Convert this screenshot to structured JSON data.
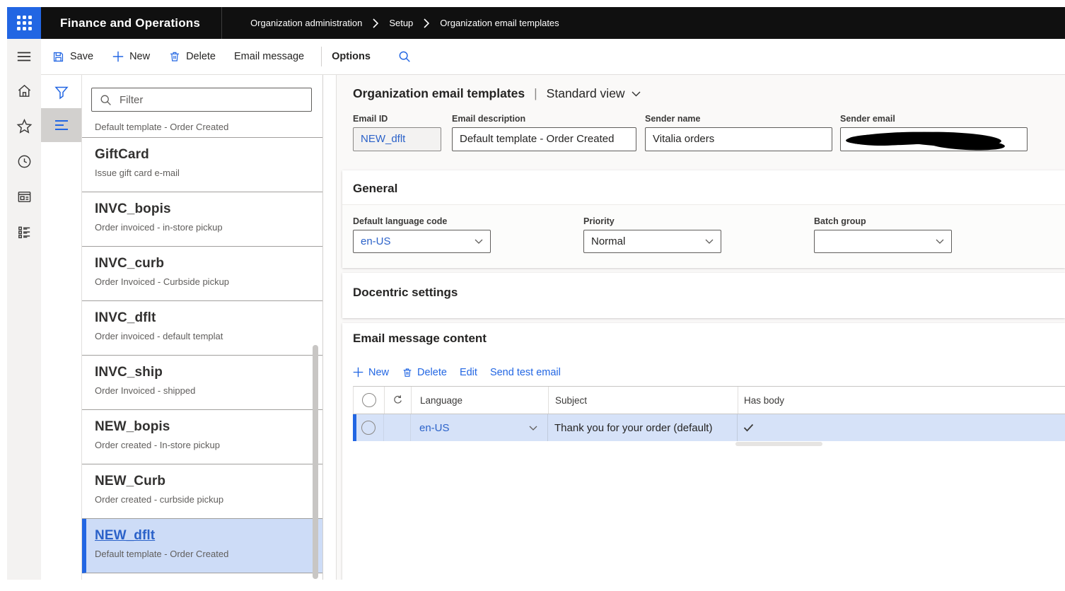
{
  "colors": {
    "accent": "#2266E3",
    "selected_row_bg": "#d6e2f8",
    "selected_item_bg": "#cddcf7",
    "topbar_bg": "#101010"
  },
  "topbar": {
    "app_title": "Finance and Operations",
    "breadcrumb": [
      "Organization administration",
      "Setup",
      "Organization email templates"
    ]
  },
  "toolbar": {
    "save_label": "Save",
    "new_label": "New",
    "delete_label": "Delete",
    "email_message_label": "Email message",
    "options_label": "Options"
  },
  "list_panel": {
    "filter_placeholder": "Filter",
    "clipped_item_subtitle": "Default template - Order Created",
    "items": [
      {
        "id": "GiftCard",
        "desc": "Issue gift card e-mail",
        "selected": false
      },
      {
        "id": "INVC_bopis",
        "desc": "Order invoiced - in-store pickup",
        "selected": false
      },
      {
        "id": "INVC_curb",
        "desc": "Order Invoiced - Curbside pickup",
        "selected": false
      },
      {
        "id": "INVC_dflt",
        "desc": "Order invoiced - default templat",
        "selected": false
      },
      {
        "id": "INVC_ship",
        "desc": "Order Invoiced - shipped",
        "selected": false
      },
      {
        "id": "NEW_bopis",
        "desc": "Order created - In-store pickup",
        "selected": false
      },
      {
        "id": "NEW_Curb",
        "desc": "Order created - curbside pickup",
        "selected": false
      },
      {
        "id": "NEW_dflt",
        "desc": "Default template - Order Created",
        "selected": true
      }
    ]
  },
  "page": {
    "title": "Organization email templates",
    "separator": "|",
    "view_selector": "Standard view",
    "fields": [
      {
        "label": "Email ID",
        "value": "NEW_dflt",
        "readonly": true
      },
      {
        "label": "Email description",
        "value": "Default template - Order Created"
      },
      {
        "label": "Sender name",
        "value": "Vitalia orders"
      },
      {
        "label": "Sender email",
        "value": "",
        "redacted": true
      }
    ]
  },
  "general_section": {
    "title": "General",
    "fields": [
      {
        "label": "Default language code",
        "value": "en-US",
        "link": true
      },
      {
        "label": "Priority",
        "value": "Normal"
      },
      {
        "label": "Batch group",
        "value": ""
      }
    ]
  },
  "docentric_section": {
    "title": "Docentric settings"
  },
  "email_content_section": {
    "title": "Email message content",
    "actions": [
      "New",
      "Delete",
      "Edit",
      "Send test email"
    ],
    "table": {
      "columns": [
        "Language",
        "Subject",
        "Has body"
      ],
      "rows": [
        {
          "language": "en-US",
          "subject": "Thank you for your order (default)",
          "has_body": true,
          "selected": true
        }
      ]
    }
  }
}
